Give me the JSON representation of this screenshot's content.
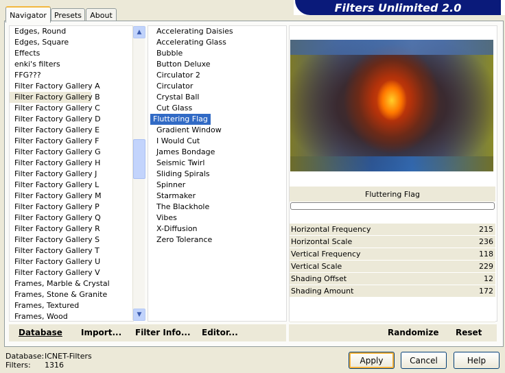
{
  "tabs": [
    {
      "label": "Navigator",
      "active": true
    },
    {
      "label": "Presets",
      "active": false
    },
    {
      "label": "About",
      "active": false
    }
  ],
  "banner_title": "Filters Unlimited 2.0",
  "categories": [
    "Edges, Round",
    "Edges, Square",
    "Effects",
    "enki's filters",
    "FFG???",
    "Filter Factory Gallery A",
    "Filter Factory Gallery B",
    "Filter Factory Gallery C",
    "Filter Factory Gallery D",
    "Filter Factory Gallery E",
    "Filter Factory Gallery F",
    "Filter Factory Gallery G",
    "Filter Factory Gallery H",
    "Filter Factory Gallery J",
    "Filter Factory Gallery L",
    "Filter Factory Gallery M",
    "Filter Factory Gallery P",
    "Filter Factory Gallery Q",
    "Filter Factory Gallery R",
    "Filter Factory Gallery S",
    "Filter Factory Gallery T",
    "Filter Factory Gallery U",
    "Filter Factory Gallery V",
    "Frames, Marble & Crystal",
    "Frames, Stone & Granite",
    "Frames, Textured",
    "Frames, Wood"
  ],
  "selected_category": "Filter Factory Gallery B",
  "filters": [
    "Accelerating Daisies",
    "Accelerating Glass",
    "Bubble",
    "Button Deluxe",
    "Circulator 2",
    "Circulator",
    "Crystal Ball",
    "Cut Glass",
    "Fluttering Flag",
    "Gradient Window",
    "I Would Cut",
    "James Bondage",
    "Seismic Twirl",
    "Sliding Spirals",
    "Spinner",
    "Starmaker",
    "The Blackhole",
    "Vibes",
    "X-Diffusion",
    "Zero Tolerance"
  ],
  "selected_filter": "Fluttering Flag",
  "preview_filter_name": "Fluttering Flag",
  "progress": 0,
  "params": [
    {
      "label": "Horizontal Frequency",
      "value": "215"
    },
    {
      "label": "Horizontal Scale",
      "value": "236"
    },
    {
      "label": "Vertical Frequency",
      "value": "118"
    },
    {
      "label": "Vertical Scale",
      "value": "229"
    },
    {
      "label": "Shading Offset",
      "value": "12"
    },
    {
      "label": "Shading Amount",
      "value": "172"
    }
  ],
  "nav_buttons": {
    "database": "Database",
    "import": "Import...",
    "filter_info": "Filter Info...",
    "editor": "Editor..."
  },
  "right_buttons": {
    "randomize": "Randomize",
    "reset": "Reset"
  },
  "status": {
    "database_label": "Database:",
    "database_value": "ICNET-Filters",
    "filters_label": "Filters:",
    "filters_value": "1316"
  },
  "dialog_buttons": {
    "apply": "Apply",
    "cancel": "Cancel",
    "help": "Help"
  },
  "colors": {
    "selection": "#316ac5",
    "banner": "#0a1a7a",
    "dialog_bg": "#ece9d8"
  }
}
